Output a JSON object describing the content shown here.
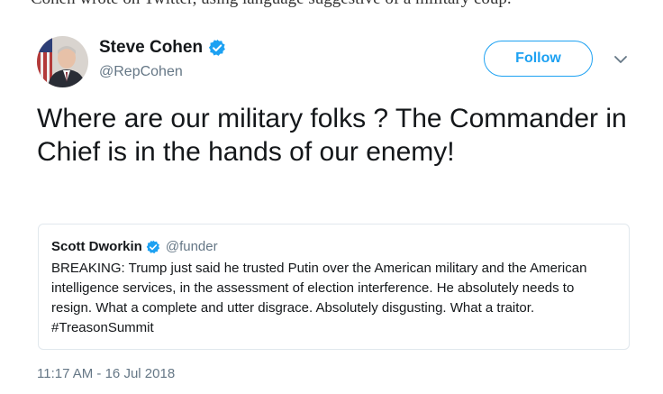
{
  "article": {
    "snippet": "Cohen wrote on Twitter, using language suggestive of a military coup."
  },
  "tweet": {
    "display_name": "Steve Cohen",
    "handle": "@RepCohen",
    "verified_icon": "verified-badge-icon",
    "follow_label": "Follow",
    "menu_icon": "chevron-down-icon",
    "text": "Where are our military folks ? The Commander in Chief is in the hands of our enemy!",
    "timestamp": "11:17 AM - 16 Jul 2018"
  },
  "quoted_tweet": {
    "display_name": "Scott Dworkin",
    "handle": "@funder",
    "verified_icon": "verified-badge-icon",
    "text": "BREAKING: Trump just said he trusted Putin over the American military and the American intelligence services, in the assessment of election interference. He absolutely needs to resign. What a complete and utter disgrace. Absolutely disgusting. What a traitor. #TreasonSummit"
  },
  "colors": {
    "accent": "#1da1f2",
    "text_primary": "#14171a",
    "text_secondary": "#657786",
    "border": "#e1e8ed"
  }
}
